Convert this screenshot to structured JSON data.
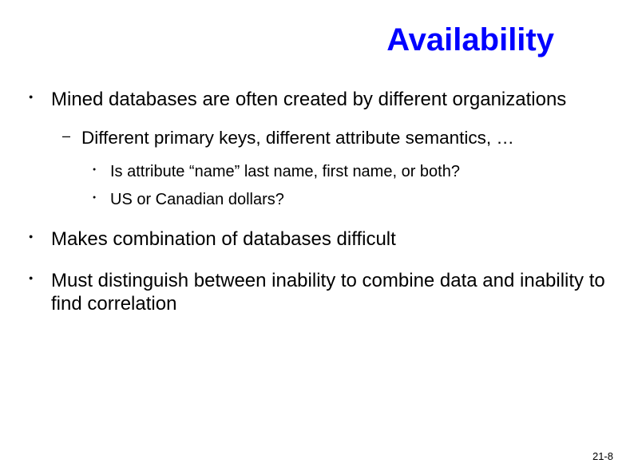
{
  "title": "Availability",
  "bullets": {
    "b1": "Mined databases are often created by different organizations",
    "b1_1": "Different primary keys, different attribute semantics, …",
    "b1_1_1": "Is attribute “name” last name, first name, or both?",
    "b1_1_2": "US or Canadian dollars?",
    "b2": "Makes combination of databases difficult",
    "b3": "Must distinguish between inability to combine data and inability to find correlation"
  },
  "page_number": "21-8"
}
